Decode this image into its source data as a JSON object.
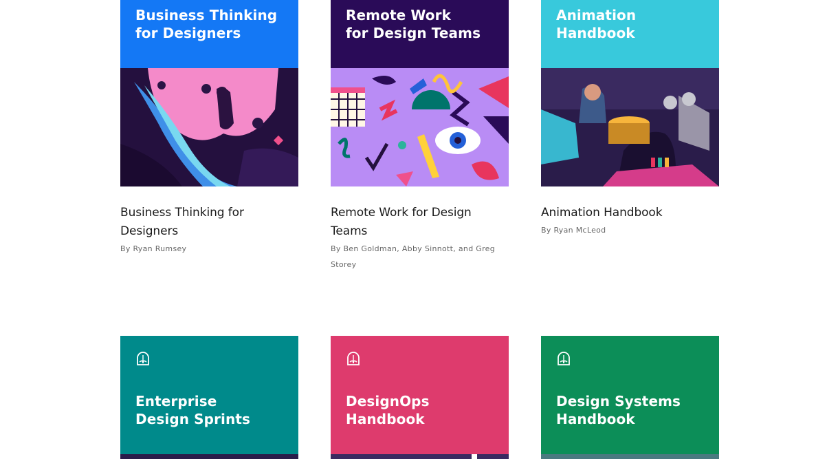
{
  "books": [
    {
      "cover_title": "Business Thinking\nfor Designers",
      "title": "Business Thinking for Designers",
      "authors": "By Ryan Rumsey",
      "cover_color": "#1478f5"
    },
    {
      "cover_title": "Remote Work\nfor Design Teams",
      "title": "Remote Work for Design Teams",
      "authors": "By Ben Goldman, Abby Sinnott, and Greg Storey",
      "cover_color": "#2a0b58"
    },
    {
      "cover_title": "Animation\nHandbook",
      "title": "Animation Handbook",
      "authors": "By Ryan McLeod",
      "cover_color": "#38c9dc"
    },
    {
      "cover_title": "Enterprise\nDesign Sprints",
      "cover_color": "#008a8b",
      "icon": "book-logo-icon"
    },
    {
      "cover_title": "DesignOps\nHandbook",
      "cover_color": "#de3b6d",
      "icon": "book-logo-icon"
    },
    {
      "cover_title": "Design Systems\nHandbook",
      "cover_color": "#0c8e58",
      "icon": "book-logo-icon"
    }
  ]
}
